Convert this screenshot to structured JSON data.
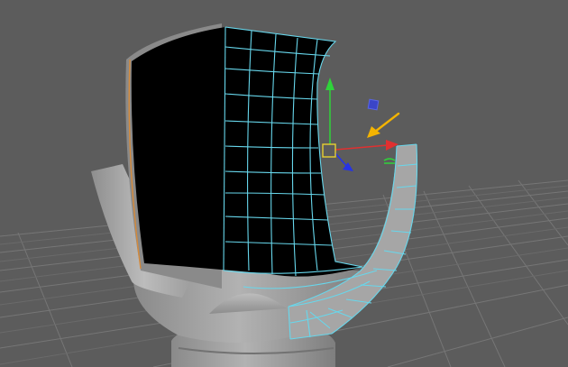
{
  "viewport": {
    "background_color": "#5c5c5c",
    "grid_color": "#787878",
    "mesh_fill_color": "#a8a8a8",
    "wireframe_color": "#67d7ec",
    "inner_face_color": "#000000",
    "selection_edge_color": "#d68a3a"
  },
  "manipulator": {
    "type": "move-tool",
    "x_axis_color": "#e03030",
    "y_axis_color": "#2fd33a",
    "z_axis_color": "#2633e6",
    "center_handle_color": "#e8d030",
    "plane_handle_color": "#3a45c8"
  },
  "annotation": {
    "arrow_color": "#f4b400",
    "icon": "arrow-pointing-to-manipulator-icon"
  }
}
